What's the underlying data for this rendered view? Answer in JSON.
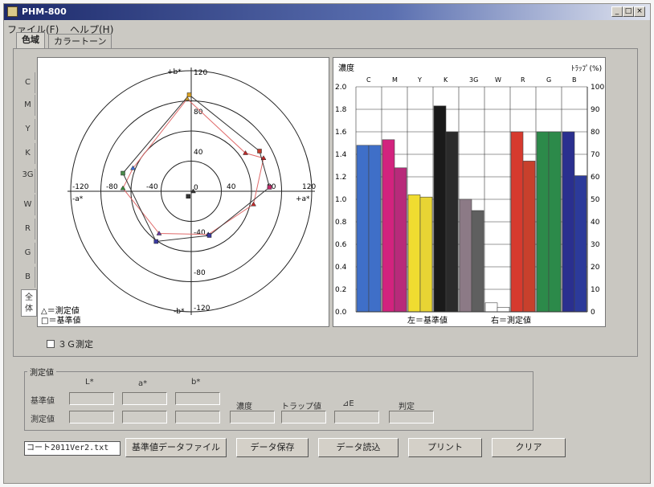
{
  "window": {
    "title": "PHM-800",
    "min": "_",
    "max": "□",
    "close": "×"
  },
  "menu": [
    "ファイル(F)",
    "ヘルプ(H)"
  ],
  "tabs": [
    "色域",
    "カラートーン"
  ],
  "side_tabs": [
    "C",
    "M",
    "Y",
    "K",
    "3G",
    "W",
    "R",
    "G",
    "B",
    "全体"
  ],
  "polar": {
    "top_label": "+b*",
    "bottom_label": "-b*",
    "right_label": "+a*",
    "left_label": "-a*",
    "ring_labels": [
      "120",
      "80",
      "40",
      "0",
      "40",
      "80",
      "120",
      "-40",
      "-80",
      "-120",
      "-120",
      "-80",
      "-40",
      "40",
      "80",
      "120"
    ],
    "legend": [
      "△＝測定値",
      "□＝基準値"
    ]
  },
  "bar_chart": {
    "left_title": "濃度",
    "right_title": "ﾄﾗｯﾌﾟ(%)",
    "categories": [
      "C",
      "M",
      "Y",
      "K",
      "3G",
      "W",
      "R",
      "G",
      "B"
    ],
    "left_ticks": [
      "2.0",
      "1.8",
      "1.6",
      "1.4",
      "1.2",
      "1.0",
      "0.8",
      "0.6",
      "0.4",
      "0.2",
      "0.0"
    ],
    "right_ticks": [
      "100",
      "90",
      "80",
      "70",
      "60",
      "50",
      "40",
      "30",
      "20",
      "10",
      "0"
    ],
    "bottom_left": "左＝基準値",
    "bottom_right": "右＝測定値"
  },
  "chart_data": [
    {
      "type": "bar",
      "title": "",
      "ylabel": "濃度",
      "y2label": "ﾄﾗｯﾌﾟ(%)",
      "ylim": [
        0,
        2.0
      ],
      "y2lim": [
        0,
        100
      ],
      "categories": [
        "C",
        "M",
        "Y",
        "K",
        "3G",
        "W",
        "R",
        "G",
        "B"
      ],
      "series": [
        {
          "name": "左＝基準値",
          "values": [
            1.48,
            1.53,
            1.04,
            1.83,
            1.0,
            0.08,
            1.6,
            1.6,
            1.6
          ],
          "colors": [
            "#3f6fc8",
            "#d2237e",
            "#f0dc30",
            "#1a1a1a",
            "#8c7a86",
            "#ffffff",
            "#d63a2e",
            "#2c8a4a",
            "#2a2f8f"
          ]
        },
        {
          "name": "右＝測定値",
          "values": [
            1.48,
            1.28,
            1.02,
            1.6,
            0.9,
            0.04,
            1.34,
            1.6,
            1.21
          ],
          "colors": [
            "#3f6fc8",
            "#b82a7a",
            "#e8d434",
            "#2b2b2b",
            "#5f5f5f",
            "#ffffff",
            "#c8402c",
            "#2c8a4a",
            "#2c3a9a"
          ]
        }
      ]
    },
    {
      "type": "scatter",
      "title": "",
      "xlabel": "+a*",
      "ylabel": "+b*",
      "xlim": [
        -120,
        120
      ],
      "ylim": [
        -120,
        120
      ],
      "series": [
        {
          "name": "△＝測定値",
          "points": [
            [
              -4,
              92
            ],
            [
              -58,
              23
            ],
            [
              -68,
              3
            ],
            [
              -32,
              -42
            ],
            [
              17,
              -43
            ],
            [
              62,
              -13
            ],
            [
              72,
              33
            ],
            [
              54,
              38
            ],
            [
              2,
              0
            ]
          ],
          "color": "#444"
        },
        {
          "name": "□＝基準値",
          "points": [
            [
              -2,
              96
            ],
            [
              -68,
              18
            ],
            [
              -35,
              -50
            ],
            [
              18,
              -44
            ],
            [
              78,
              4
            ],
            [
              68,
              40
            ],
            [
              -3,
              -5
            ]
          ],
          "color": "#444"
        }
      ]
    }
  ],
  "checkbox_label": "３Ｇ測定",
  "measure": {
    "group_label": "測定値",
    "row_labels": [
      "基準値",
      "測定値"
    ],
    "col_labels": [
      "L*",
      "a*",
      "b*"
    ],
    "extra_labels": [
      "濃度",
      "トラップ値",
      "⊿E",
      "判定"
    ]
  },
  "file_name": "コート2011Ver2.txt",
  "buttons": [
    "基準値データファイル",
    "データ保存",
    "データ読込",
    "プリント",
    "クリア"
  ]
}
